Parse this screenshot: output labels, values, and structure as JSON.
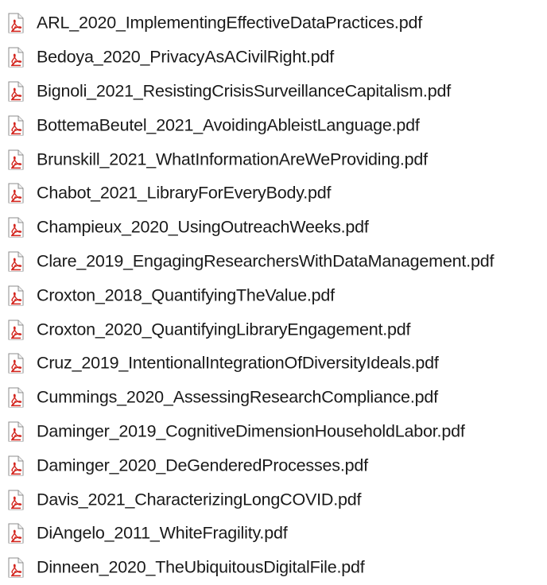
{
  "files": [
    {
      "name": "ARL_2020_ImplementingEffectiveDataPractices.pdf",
      "icon": "pdf-file-icon"
    },
    {
      "name": "Bedoya_2020_PrivacyAsACivilRight.pdf",
      "icon": "pdf-file-icon"
    },
    {
      "name": "Bignoli_2021_ResistingCrisisSurveillanceCapitalism.pdf",
      "icon": "pdf-file-icon"
    },
    {
      "name": "BottemaBeutel_2021_AvoidingAbleistLanguage.pdf",
      "icon": "pdf-file-icon"
    },
    {
      "name": "Brunskill_2021_WhatInformationAreWeProviding.pdf",
      "icon": "pdf-file-icon"
    },
    {
      "name": "Chabot_2021_LibraryForEveryBody.pdf",
      "icon": "pdf-file-icon"
    },
    {
      "name": "Champieux_2020_UsingOutreachWeeks.pdf",
      "icon": "pdf-file-icon"
    },
    {
      "name": "Clare_2019_EngagingResearchersWithDataManagement.pdf",
      "icon": "pdf-file-icon"
    },
    {
      "name": "Croxton_2018_QuantifyingTheValue.pdf",
      "icon": "pdf-file-icon"
    },
    {
      "name": "Croxton_2020_QuantifyingLibraryEngagement.pdf",
      "icon": "pdf-file-icon"
    },
    {
      "name": "Cruz_2019_IntentionalIntegrationOfDiversityIdeals.pdf",
      "icon": "pdf-file-icon"
    },
    {
      "name": "Cummings_2020_AssessingResearchCompliance.pdf",
      "icon": "pdf-file-icon"
    },
    {
      "name": "Daminger_2019_CognitiveDimensionHouseholdLabor.pdf",
      "icon": "pdf-file-icon"
    },
    {
      "name": "Daminger_2020_DeGenderedProcesses.pdf",
      "icon": "pdf-file-icon"
    },
    {
      "name": "Davis_2021_CharacterizingLongCOVID.pdf",
      "icon": "pdf-file-icon"
    },
    {
      "name": "DiAngelo_2011_WhiteFragility.pdf",
      "icon": "pdf-file-icon"
    },
    {
      "name": "Dinneen_2020_TheUbiquitousDigitalFile.pdf",
      "icon": "pdf-file-icon"
    }
  ],
  "colors": {
    "icon_red": "#d3261f",
    "icon_page": "#ffffff",
    "icon_border": "#8c8c8c",
    "text": "#1a1a1a"
  }
}
